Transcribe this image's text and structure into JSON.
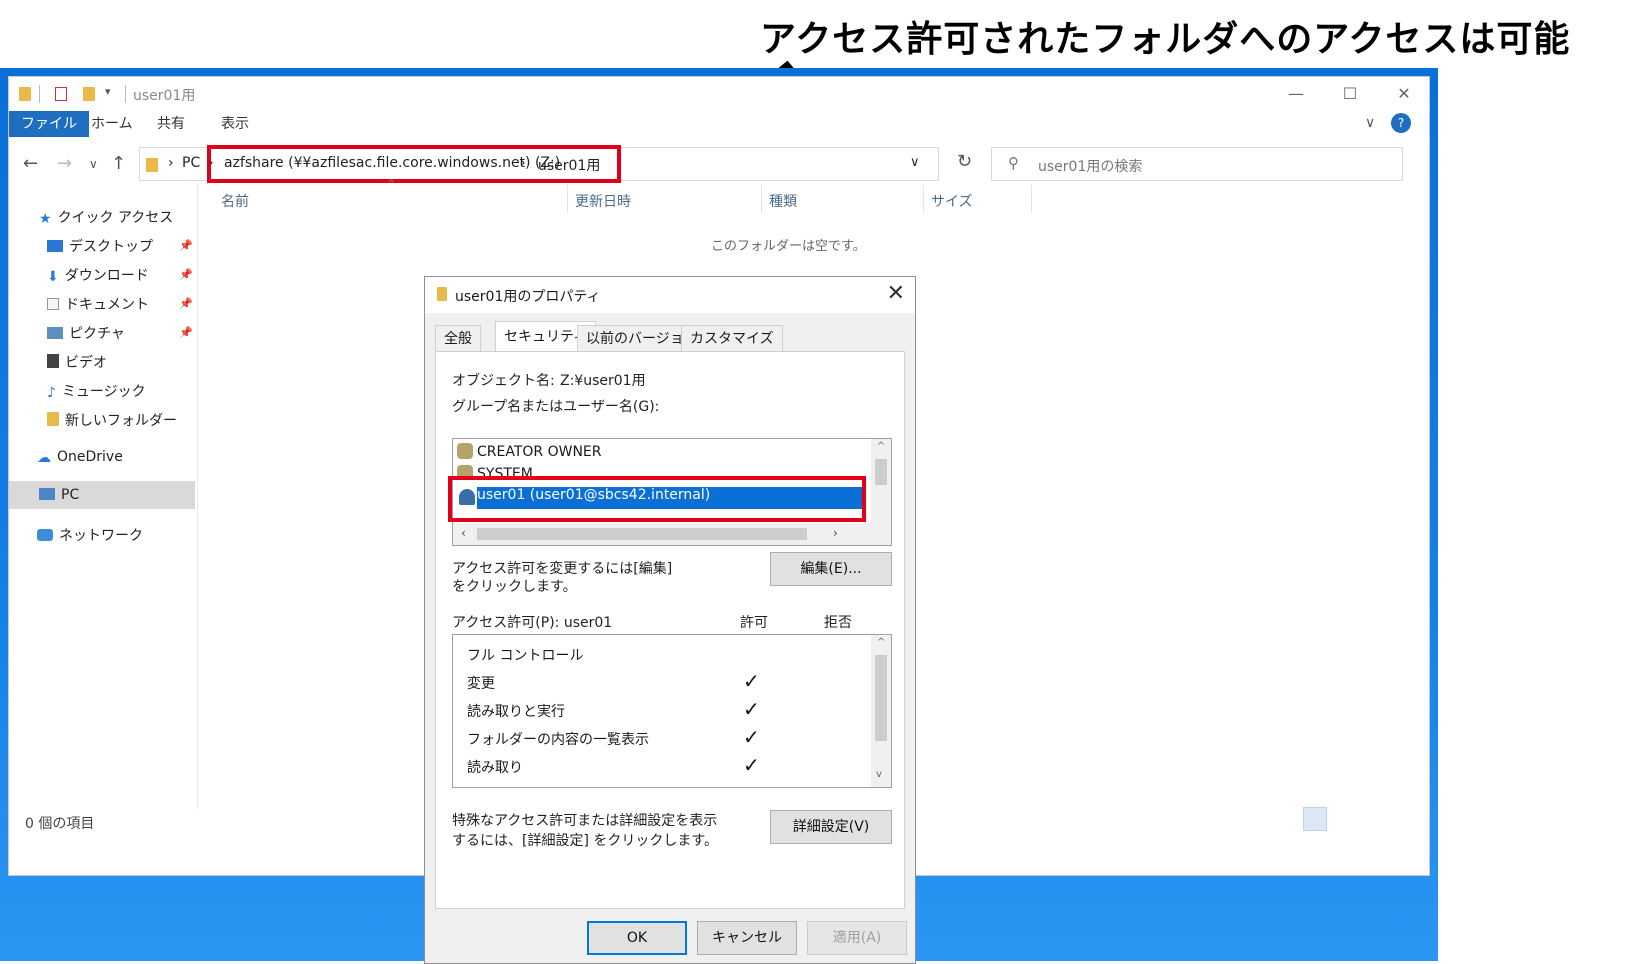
{
  "annotation": {
    "title": "アクセス許可されたフォルダへのアクセスは可能"
  },
  "explorer": {
    "title": "user01用",
    "ribbon_tabs": [
      "ファイル",
      "ホーム",
      "共有",
      "表示"
    ],
    "breadcrumb": {
      "root": "PC",
      "share": "azfshare (¥¥azfilesac.file.core.windows.net) (Z:)",
      "folder": "user01用"
    },
    "search_placeholder": "user01用の検索",
    "columns": [
      "名前",
      "更新日時",
      "種類",
      "サイズ"
    ],
    "empty_message": "このフォルダーは空です。",
    "sidebar": {
      "quick_access": "クイック アクセス",
      "items": [
        "デスクトップ",
        "ダウンロード",
        "ドキュメント",
        "ピクチャ",
        "ビデオ",
        "ミュージック",
        "新しいフォルダー"
      ],
      "onedrive": "OneDrive",
      "pc": "PC",
      "network": "ネットワーク"
    },
    "status": "0 個の項目"
  },
  "dialog": {
    "title": "user01用のプロパティ",
    "tabs": [
      "全般",
      "セキュリティ",
      "以前のバージョン",
      "カスタマイズ"
    ],
    "object_label": "オブジェクト名:",
    "object_value": "Z:¥user01用",
    "group_label": "グループ名またはユーザー名(G):",
    "principals": [
      "CREATOR OWNER",
      "SYSTEM",
      "user01 (user01@sbcs42.internal)"
    ],
    "change_text_1": "アクセス許可を変更するには[編集]",
    "change_text_2": "をクリックします。",
    "edit_button": "編集(E)...",
    "perm_label": "アクセス許可(P): user01",
    "allow_header": "許可",
    "deny_header": "拒否",
    "permissions": [
      "フル コントロール",
      "変更",
      "読み取りと実行",
      "フォルダーの内容の一覧表示",
      "読み取り"
    ],
    "allowed": [
      false,
      true,
      true,
      true,
      true
    ],
    "special_text_1": "特殊なアクセス許可または詳細設定を表示",
    "special_text_2": "するには、[詳細設定] をクリックします。",
    "advanced_button": "詳細設定(V)",
    "ok": "OK",
    "cancel": "キャンセル",
    "apply": "適用(A)"
  }
}
